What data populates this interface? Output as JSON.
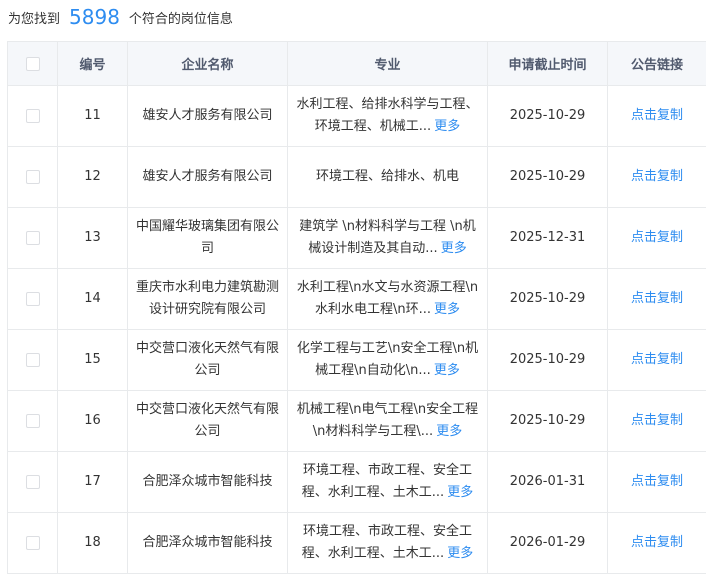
{
  "summary": {
    "prefix": "为您找到",
    "count": "5898",
    "suffix": "个符合的岗位信息"
  },
  "columns": {
    "num": "编号",
    "company": "企业名称",
    "major": "专业",
    "deadline": "申请截止时间",
    "link": "公告链接"
  },
  "more_label": "更多",
  "copy_label": "点击复制",
  "rows": [
    {
      "num": "11",
      "company": "雄安人才服务有限公司",
      "major": "水利工程、给排水科学与工程、环境工程、机械工...",
      "more": true,
      "deadline": "2025-10-29"
    },
    {
      "num": "12",
      "company": "雄安人才服务有限公司",
      "major": "环境工程、给排水、机电",
      "more": false,
      "deadline": "2025-10-29"
    },
    {
      "num": "13",
      "company": "中国耀华玻璃集团有限公司",
      "major": "建筑学 \\n材料科学与工程 \\n机械设计制造及其自动...",
      "more": true,
      "deadline": "2025-12-31"
    },
    {
      "num": "14",
      "company": "重庆市水利电力建筑勘测设计研究院有限公司",
      "major": "水利工程\\n水文与水资源工程\\n水利水电工程\\n环...",
      "more": true,
      "deadline": "2025-10-29"
    },
    {
      "num": "15",
      "company": "中交营口液化天然气有限公司",
      "major": "化学工程与工艺\\n安全工程\\n机械工程\\n自动化\\n...",
      "more": true,
      "deadline": "2025-10-29"
    },
    {
      "num": "16",
      "company": "中交营口液化天然气有限公司",
      "major": "机械工程\\n电气工程\\n安全工程\\n材料科学与工程\\...",
      "more": true,
      "deadline": "2025-10-29"
    },
    {
      "num": "17",
      "company": "合肥泽众城市智能科技",
      "major": "环境工程、市政工程、安全工程、水利工程、土木工...",
      "more": true,
      "deadline": "2026-01-31"
    },
    {
      "num": "18",
      "company": "合肥泽众城市智能科技",
      "major": "环境工程、市政工程、安全工程、水利工程、土木工...",
      "more": true,
      "deadline": "2026-01-29"
    }
  ]
}
